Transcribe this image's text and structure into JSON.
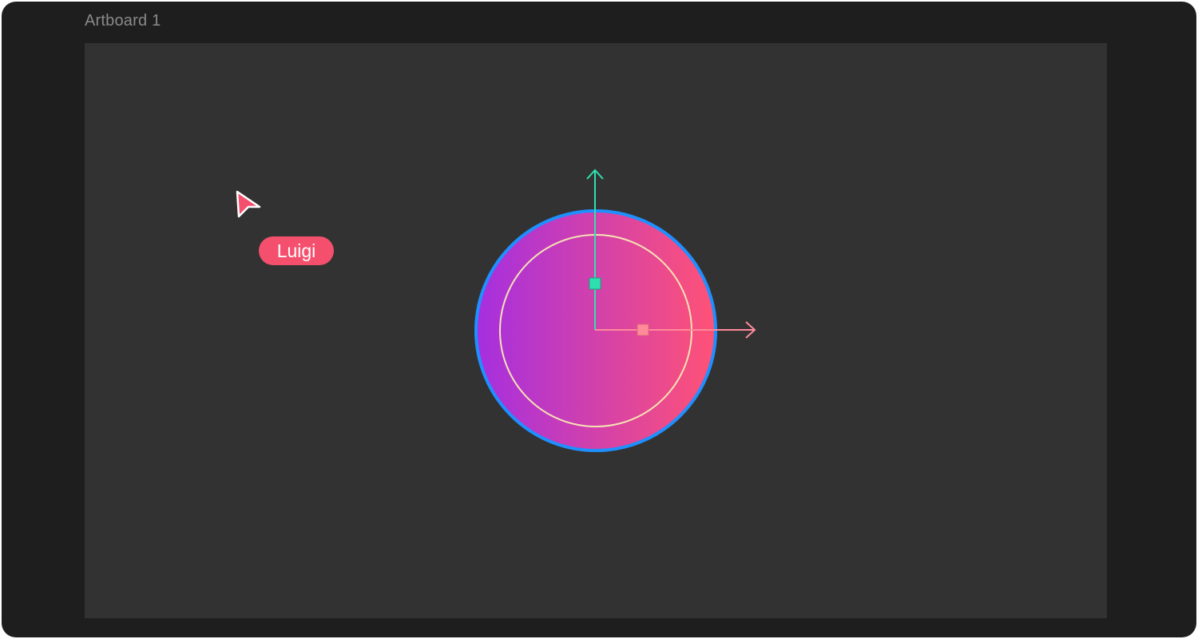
{
  "artboard": {
    "label": "Artboard 1"
  },
  "collaborator": {
    "name": "Luigi",
    "color": "#f4506e"
  },
  "canvas": {
    "background": "#323232",
    "frame_background": "#1e1e1e"
  },
  "shape": {
    "type": "ellipse",
    "fill_gradient": [
      "#a52fe0",
      "#ff5276"
    ],
    "selection_stroke": "#1e90ff",
    "inner_ring_stroke": "#f6e3b4"
  },
  "gizmo": {
    "y_axis_color": "#2ee0b0",
    "x_axis_color": "#ff8a9a",
    "icons": [
      "arrow-up-icon",
      "arrow-right-icon",
      "square-handle-icon"
    ]
  }
}
